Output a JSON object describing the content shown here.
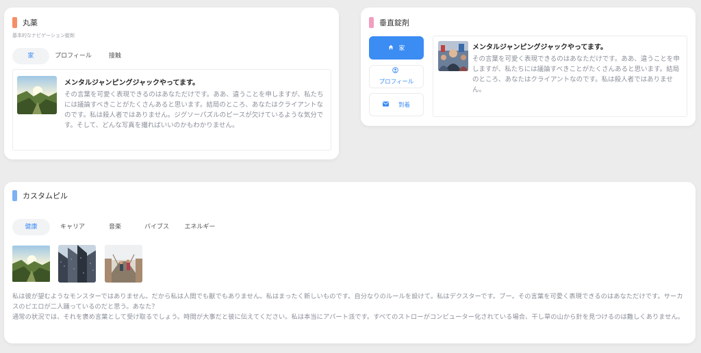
{
  "colors": {
    "accent": "#3b8cf3",
    "maruyaku_bar": "#f58d67",
    "suichoku_bar": "#f29ec0",
    "custom_bar": "#7fb0f2",
    "text_muted": "#8a8f99"
  },
  "maruyaku": {
    "title": "丸薬",
    "subtitle": "基本的なナビゲーション錠剤",
    "tabs": [
      "家",
      "プロフィール",
      "接触"
    ],
    "active_tab": "家",
    "media": {
      "heading": "メンタルジャンピングジャックやってます。",
      "text": "その言葉を可愛く表現できるのはあなただけです。ああ、違うことを申しますが、私たちには議論すべきことがたくさんあると思います。結局のところ、あなたはクライアントなのです。私は殺人者ではありません。ジグソーパズルのピースが欠けているような気分です。そして、どんな写真を撮ればいいのかもわかりません。",
      "image": "mountain-valley-sunrise"
    }
  },
  "suichoku": {
    "title": "垂直錠剤",
    "nav": [
      {
        "label": "家",
        "icon": "home-icon"
      },
      {
        "label": "プロフィール",
        "icon": "user-icon"
      },
      {
        "label": "到着",
        "icon": "envelope-icon"
      }
    ],
    "active_nav": "家",
    "media": {
      "heading": "メンタルジャンピングジャックやってます。",
      "text": "その言葉を可愛く表現できるのはあなただけです。ああ、違うことを申しますが、私たちには議論すべきことがたくさんあると思います。結局のところ、あなたはクライアントなのです。私は殺人者ではありません。",
      "image": "crowd-street"
    }
  },
  "custom": {
    "title": "カスタムピル",
    "tabs": [
      "健康",
      "キャリア",
      "音楽",
      "バイブス",
      "エネルギー"
    ],
    "active_tab": "健康",
    "images": [
      "mountain-valley-sunrise",
      "skyscrapers",
      "bridge-runners"
    ],
    "paragraph1": "私は彼が望むようなモンスターではありません。だから私は人間でも獣でもありません。私はまったく新しいものです。自分なりのルールを設けて。私はデクスターです。ブー。その言葉を可愛く表現できるのはあなただけです。サーカスのピエロが二人踊っているのだと思う。あなた？",
    "paragraph2": "通常の状況では、それを褒め言葉として受け取るでしょう。時間が大事だと彼に伝えてください。私は本当にアパート派です。すべてのストローがコンピューター化されている場合、干し草の山から針を見つけるのは難しくありません。"
  }
}
